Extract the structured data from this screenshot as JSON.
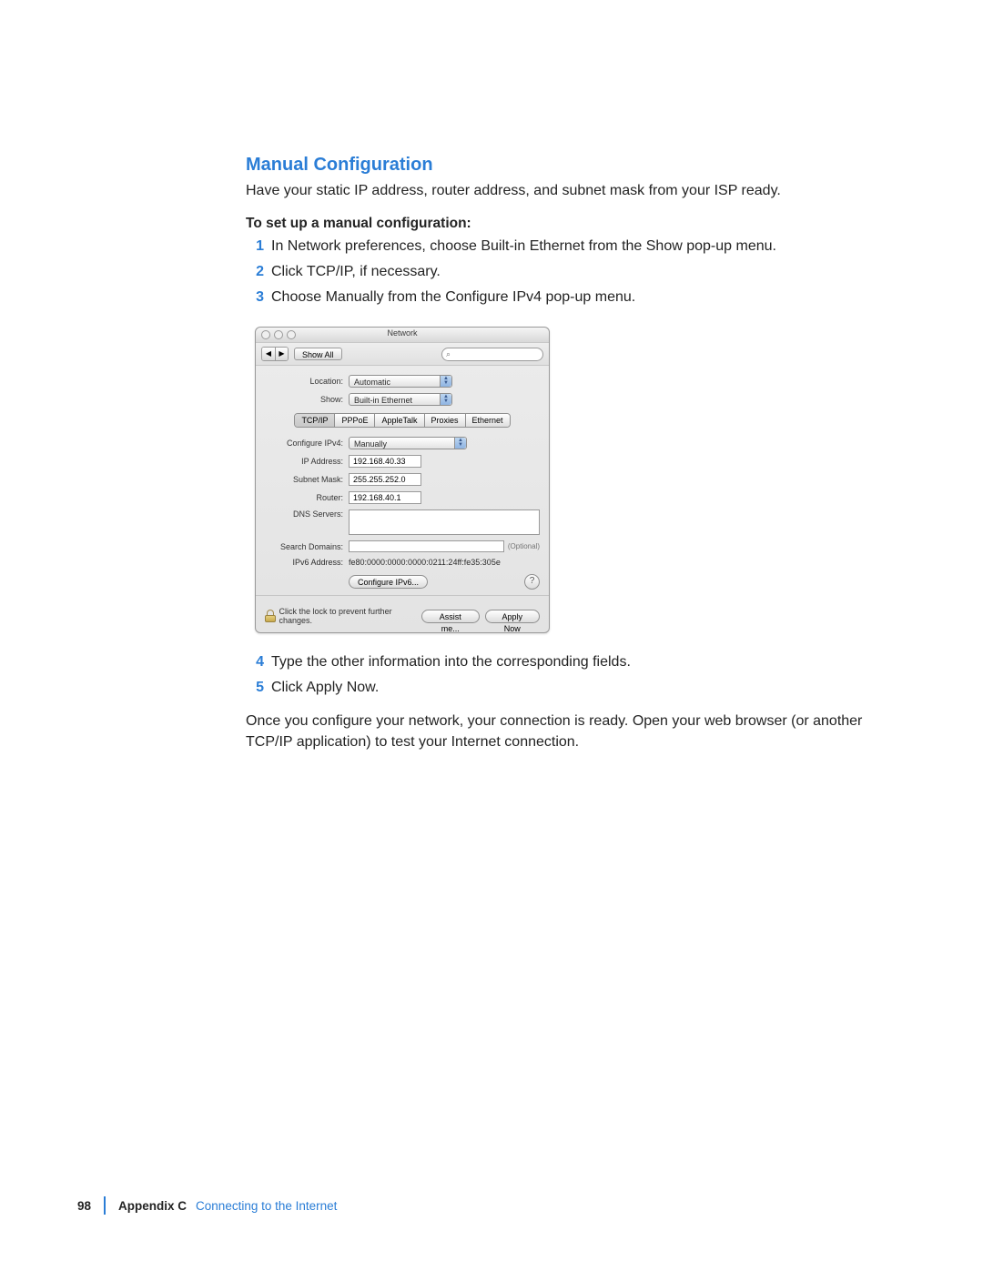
{
  "heading": "Manual Configuration",
  "intro": "Have your static IP address, router address, and subnet mask from your ISP ready.",
  "subhead": "To set up a manual configuration:",
  "steps_a": [
    "In Network preferences, choose Built-in Ethernet from the Show pop-up menu.",
    "Click TCP/IP, if necessary.",
    "Choose Manually from the Configure IPv4 pop-up menu."
  ],
  "steps_b": [
    "Type the other information into the corresponding fields.",
    "Click Apply Now."
  ],
  "closing": "Once you configure your network, your connection is ready. Open your web browser (or another TCP/IP application) to test your Internet connection.",
  "footer": {
    "page": "98",
    "appendix": "Appendix C",
    "title": "Connecting to the Internet"
  },
  "window": {
    "title": "Network",
    "toolbar": {
      "show_all": "Show All",
      "search_placeholder": ""
    },
    "location": {
      "label": "Location:",
      "value": "Automatic"
    },
    "show": {
      "label": "Show:",
      "value": "Built-in Ethernet"
    },
    "tabs": [
      "TCP/IP",
      "PPPoE",
      "AppleTalk",
      "Proxies",
      "Ethernet"
    ],
    "active_tab": "TCP/IP",
    "configure_ipv4": {
      "label": "Configure IPv4:",
      "value": "Manually"
    },
    "ip_address": {
      "label": "IP Address:",
      "value": "192.168.40.33"
    },
    "subnet_mask": {
      "label": "Subnet Mask:",
      "value": "255.255.252.0"
    },
    "router": {
      "label": "Router:",
      "value": "192.168.40.1"
    },
    "dns": {
      "label": "DNS Servers:",
      "value": ""
    },
    "search": {
      "label": "Search Domains:",
      "value": "",
      "optional": "(Optional)"
    },
    "ipv6": {
      "label": "IPv6 Address:",
      "value": "fe80:0000:0000:0000:0211:24ff:fe35:305e"
    },
    "configure_ipv6_btn": "Configure IPv6...",
    "lock_text": "Click the lock to prevent further changes.",
    "assist_btn": "Assist me...",
    "apply_btn": "Apply Now"
  }
}
